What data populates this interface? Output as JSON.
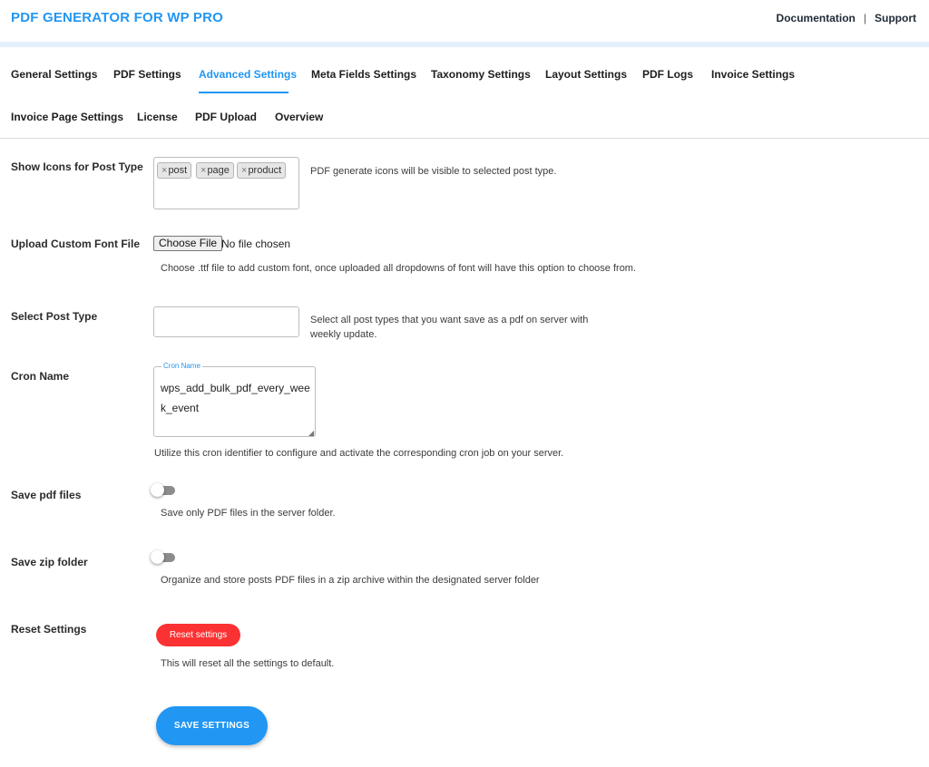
{
  "header": {
    "brand": "PDF GENERATOR FOR WP PRO",
    "links": [
      "Documentation",
      "Support"
    ],
    "separator": "|"
  },
  "tabs": [
    {
      "label": "General Settings",
      "active": false
    },
    {
      "label": "PDF Settings",
      "active": false
    },
    {
      "label": "Advanced Settings",
      "active": true
    },
    {
      "label": "Meta Fields Settings",
      "active": false
    },
    {
      "label": "Taxonomy Settings",
      "active": false
    },
    {
      "label": "Layout Settings",
      "active": false
    },
    {
      "label": "PDF Logs",
      "active": false
    },
    {
      "label": "Invoice Settings",
      "active": false
    },
    {
      "label": "Invoice Page Settings",
      "active": false
    },
    {
      "label": "License",
      "active": false
    },
    {
      "label": "PDF Upload",
      "active": false
    },
    {
      "label": "Overview",
      "active": false
    }
  ],
  "settings": {
    "show_icons": {
      "label": "Show Icons for Post Type",
      "chips": [
        "post",
        "page",
        "product"
      ],
      "chip_remove": "×",
      "description": "PDF generate icons will be visible to selected post type."
    },
    "custom_font": {
      "label": "Upload Custom Font File",
      "button": "Choose File",
      "status": "No file chosen",
      "description": "Choose .ttf file to add custom font, once uploaded all dropdowns of font will have this option to choose from."
    },
    "post_type": {
      "label": "Select Post Type",
      "value": "",
      "description_line1": "Select all post types that you want save as a pdf on server with",
      "description_line2": "weekly update."
    },
    "cron": {
      "label": "Cron Name",
      "legend": "Cron Name",
      "value": "wps_add_bulk_pdf_every_week_event",
      "description": "Utilize this cron identifier to configure and activate the corresponding cron job on your server."
    },
    "save_pdf": {
      "label": "Save pdf files",
      "enabled": false,
      "description": "Save only PDF files in the server folder."
    },
    "save_zip": {
      "label": "Save zip folder",
      "enabled": false,
      "description": "Organize and store posts PDF files in a zip archive within the designated server folder"
    },
    "reset": {
      "label": "Reset Settings",
      "button": "Reset settings",
      "description": "This will reset all the settings to default."
    }
  },
  "actions": {
    "save": "SAVE SETTINGS"
  },
  "colors": {
    "accent": "#2196f3",
    "danger": "#fb3233"
  }
}
